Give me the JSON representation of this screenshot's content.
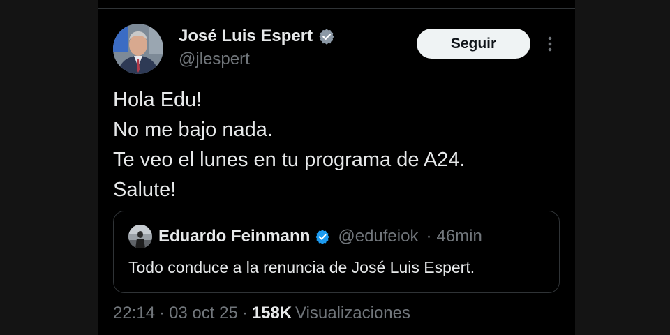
{
  "author": {
    "name": "José Luis Espert",
    "handle": "@jlespert"
  },
  "follow_button": {
    "label": "Seguir"
  },
  "tweet": {
    "lines": [
      "Hola Edu!",
      "No me bajo nada.",
      "Te veo el lunes en tu programa de A24.",
      "Salute!"
    ]
  },
  "quoted": {
    "name": "Eduardo Feinmann",
    "handle": "@edufeiok",
    "separator": "·",
    "time": "46min",
    "text": "Todo conduce a la renuncia de José Luis Espert."
  },
  "footer": {
    "time": "22:14",
    "date": "03 oct 25",
    "views_count": "158K",
    "views_label": "Visualizaciones",
    "separator": "·"
  },
  "icons": {
    "verified": "verified-badge-icon",
    "more": "more-vertical-icon"
  },
  "colors": {
    "verified": "#1d9bf0",
    "text_primary": "#e7e9ea",
    "text_secondary": "#71767b",
    "background": "#000000"
  }
}
